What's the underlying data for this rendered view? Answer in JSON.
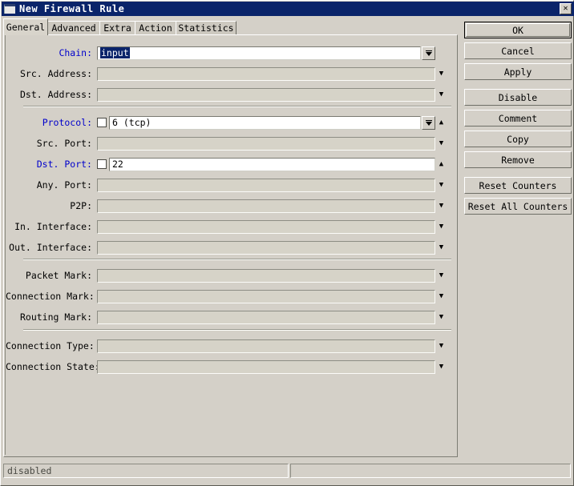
{
  "window": {
    "title": "New Firewall Rule",
    "icon": "window-icon",
    "close_label": "✕"
  },
  "tabs": [
    {
      "label": "General",
      "active": true
    },
    {
      "label": "Advanced",
      "active": false
    },
    {
      "label": "Extra",
      "active": false
    },
    {
      "label": "Action",
      "active": false
    },
    {
      "label": "Statistics",
      "active": false
    }
  ],
  "form": {
    "rows": [
      {
        "label": "Chain:",
        "blue": true,
        "enabled": true,
        "value": "input",
        "selected": true,
        "checkbox": false,
        "combo": true,
        "arrow": ""
      },
      {
        "label": "Src. Address:",
        "blue": false,
        "enabled": false,
        "value": "",
        "selected": false,
        "checkbox": false,
        "combo": false,
        "arrow": "▼"
      },
      {
        "label": "Dst. Address:",
        "blue": false,
        "enabled": false,
        "value": "",
        "selected": false,
        "checkbox": false,
        "combo": false,
        "arrow": "▼"
      },
      {
        "label": "Protocol:",
        "blue": true,
        "enabled": true,
        "value": "6 (tcp)",
        "selected": false,
        "checkbox": true,
        "combo": true,
        "arrow": "▲"
      },
      {
        "label": "Src. Port:",
        "blue": false,
        "enabled": false,
        "value": "",
        "selected": false,
        "checkbox": false,
        "combo": false,
        "arrow": "▼"
      },
      {
        "label": "Dst. Port:",
        "blue": true,
        "enabled": true,
        "value": "22",
        "selected": false,
        "checkbox": true,
        "combo": false,
        "arrow": "▲"
      },
      {
        "label": "Any. Port:",
        "blue": false,
        "enabled": false,
        "value": "",
        "selected": false,
        "checkbox": false,
        "combo": false,
        "arrow": "▼"
      },
      {
        "label": "P2P:",
        "blue": false,
        "enabled": false,
        "value": "",
        "selected": false,
        "checkbox": false,
        "combo": false,
        "arrow": "▼"
      },
      {
        "label": "In. Interface:",
        "blue": false,
        "enabled": false,
        "value": "",
        "selected": false,
        "checkbox": false,
        "combo": false,
        "arrow": "▼"
      },
      {
        "label": "Out. Interface:",
        "blue": false,
        "enabled": false,
        "value": "",
        "selected": false,
        "checkbox": false,
        "combo": false,
        "arrow": "▼"
      },
      {
        "label": "Packet Mark:",
        "blue": false,
        "enabled": false,
        "value": "",
        "selected": false,
        "checkbox": false,
        "combo": false,
        "arrow": "▼"
      },
      {
        "label": "Connection Mark:",
        "blue": false,
        "enabled": false,
        "value": "",
        "selected": false,
        "checkbox": false,
        "combo": false,
        "arrow": "▼"
      },
      {
        "label": "Routing Mark:",
        "blue": false,
        "enabled": false,
        "value": "",
        "selected": false,
        "checkbox": false,
        "combo": false,
        "arrow": "▼"
      },
      {
        "label": "Connection Type:",
        "blue": false,
        "enabled": false,
        "value": "",
        "selected": false,
        "checkbox": false,
        "combo": false,
        "arrow": "▼"
      },
      {
        "label": "Connection State:",
        "blue": false,
        "enabled": false,
        "value": "",
        "selected": false,
        "checkbox": false,
        "combo": false,
        "arrow": "▼"
      }
    ]
  },
  "buttons": [
    {
      "label": "OK",
      "focus": true
    },
    {
      "label": "Cancel",
      "focus": false
    },
    {
      "label": "Apply",
      "focus": false
    },
    {
      "label": "Disable",
      "focus": false
    },
    {
      "label": "Comment",
      "focus": false
    },
    {
      "label": "Copy",
      "focus": false
    },
    {
      "label": "Remove",
      "focus": false
    },
    {
      "label": "Reset Counters",
      "focus": false
    },
    {
      "label": "Reset All Counters",
      "focus": false
    }
  ],
  "statusbar": {
    "main": "disabled",
    "extra": ""
  },
  "colors": {
    "titlebar": "#0a246a",
    "face": "#d4d0c8",
    "active_label": "#0000cc",
    "selection": "#0a246a",
    "field_disabled": "#d6d3c8"
  }
}
